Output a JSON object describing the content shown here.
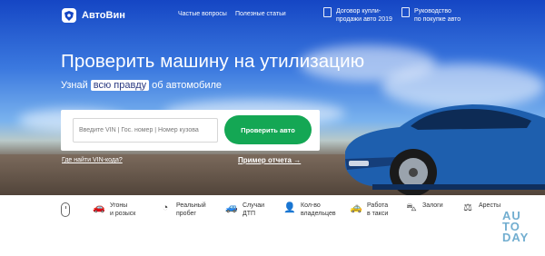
{
  "header": {
    "brand": "АвтоВин",
    "nav": [
      "Частые вопросы",
      "Полезные статьи"
    ],
    "docs": [
      {
        "icon": "document-icon",
        "label": "Договор купли-\nпродажи авто 2019"
      },
      {
        "icon": "document-icon",
        "label": "Руководство\nпо покупке авто"
      }
    ]
  },
  "hero": {
    "title": "Проверить машину на утилизацию",
    "subtitle_before": "Узнай",
    "subtitle_highlight": "всю правду",
    "subtitle_after": "об автомобиле"
  },
  "search": {
    "placeholder": "Введите VIN | Гос. номер | Номер кузова",
    "button": "Проверить авто"
  },
  "links": {
    "vin_help": "Где найти VIN-кода?",
    "report_example": "Пример отчета",
    "report_arrow": "→"
  },
  "features": [
    {
      "icon": "car-chase-icon",
      "label": "Угоны\nи розыск"
    },
    {
      "icon": "speedometer-icon",
      "label": "Реальный\nпробег"
    },
    {
      "icon": "car-crash-icon",
      "label": "Случаи\nДТП"
    },
    {
      "icon": "person-icon",
      "label": "Кол-во\nвладельцев"
    },
    {
      "icon": "taxi-icon",
      "label": "Работа\nв такси"
    },
    {
      "icon": "pledge-icon",
      "label": "Залоги"
    },
    {
      "icon": "arrest-icon",
      "label": "Аресты"
    }
  ],
  "watermark": {
    "line1": "AU",
    "line2": "TO",
    "line3": "DAY"
  },
  "colors": {
    "primary_blue": "#1546c4",
    "button_green": "#14a754"
  }
}
